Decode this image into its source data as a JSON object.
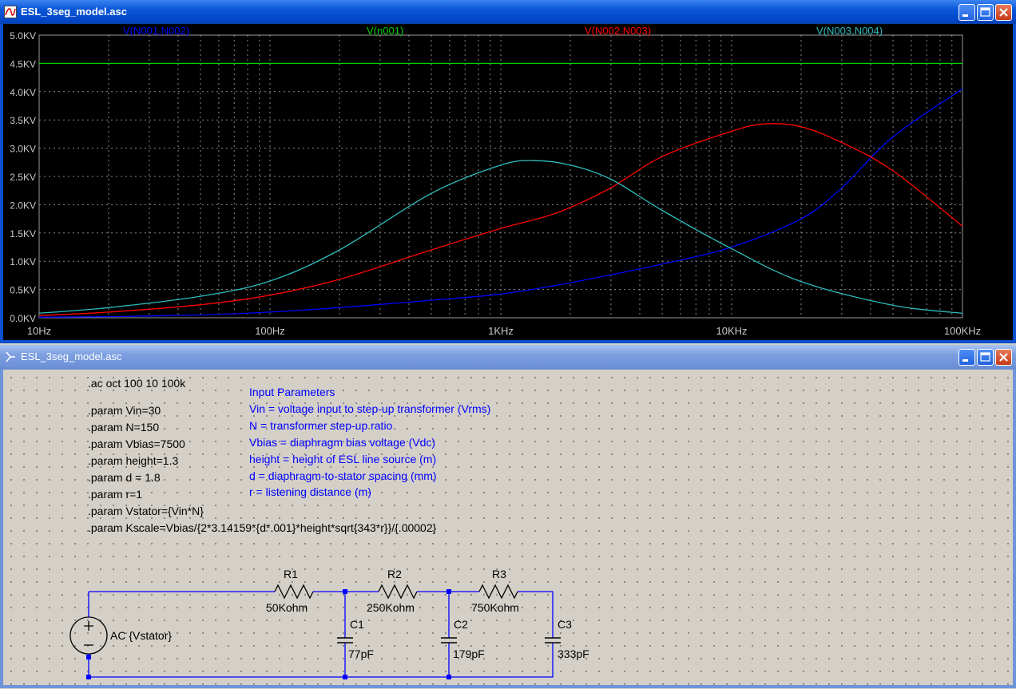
{
  "plot_window": {
    "title": "ESL_3seg_model.asc",
    "icon": "waveform-icon",
    "buttons": [
      "minimize-icon",
      "maximize-icon",
      "close-icon"
    ]
  },
  "schematic_window": {
    "title": "ESL_3seg_model.asc",
    "icon": "schematic-icon",
    "buttons": [
      "minimize-icon",
      "maximize-icon",
      "close-icon"
    ]
  },
  "colors": {
    "plot_bg": "#000000",
    "grid": "#8a8a8a",
    "axis_text": "#c8c8c8",
    "trace_blue": "#0000ff",
    "trace_green": "#00d000",
    "trace_red": "#ff0000",
    "trace_cyan": "#2fbcbc",
    "wire": "#0000ff",
    "directive_text": "#000000",
    "comment_text": "#0000ff"
  },
  "chart_data": {
    "type": "line",
    "xscale": "log",
    "xlim": [
      10,
      100000
    ],
    "ylim": [
      0,
      5000
    ],
    "grid": true,
    "xticks": [
      {
        "value": 10,
        "label": "10Hz"
      },
      {
        "value": 100,
        "label": "100Hz"
      },
      {
        "value": 1000,
        "label": "1KHz"
      },
      {
        "value": 10000,
        "label": "10KHz"
      },
      {
        "value": 100000,
        "label": "100KHz"
      }
    ],
    "yticks": [
      {
        "value": 0,
        "label": "0.0KV"
      },
      {
        "value": 500,
        "label": "0.5KV"
      },
      {
        "value": 1000,
        "label": "1.0KV"
      },
      {
        "value": 1500,
        "label": "1.5KV"
      },
      {
        "value": 2000,
        "label": "2.0KV"
      },
      {
        "value": 2500,
        "label": "2.5KV"
      },
      {
        "value": 3000,
        "label": "3.0KV"
      },
      {
        "value": 3500,
        "label": "3.5KV"
      },
      {
        "value": 4000,
        "label": "4.0KV"
      },
      {
        "value": 4500,
        "label": "4.5KV"
      },
      {
        "value": 5000,
        "label": "5.0KV"
      }
    ],
    "series": [
      {
        "name": "V(N001,N002)",
        "color": "#0000ff",
        "x": [
          10,
          20,
          50,
          100,
          200,
          500,
          1000,
          2000,
          5000,
          10000,
          20000,
          30000,
          50000,
          100000
        ],
        "y": [
          10,
          20,
          50,
          100,
          180,
          310,
          420,
          620,
          950,
          1250,
          1750,
          2300,
          3200,
          4050
        ]
      },
      {
        "name": "V(n001)",
        "color": "#00d000",
        "x": [
          10,
          100000
        ],
        "y": [
          4500,
          4500
        ]
      },
      {
        "name": "V(N002,N003)",
        "color": "#ff0000",
        "x": [
          10,
          20,
          50,
          100,
          200,
          500,
          1000,
          1500,
          2000,
          3000,
          5000,
          10000,
          14000,
          20000,
          30000,
          50000,
          100000
        ],
        "y": [
          40,
          100,
          230,
          400,
          680,
          1200,
          1580,
          1770,
          1950,
          2300,
          2850,
          3300,
          3430,
          3380,
          3100,
          2600,
          1620
        ]
      },
      {
        "name": "V(N003,N004)",
        "color": "#2fbcbc",
        "x": [
          10,
          20,
          50,
          100,
          200,
          500,
          1000,
          1400,
          2000,
          3000,
          5000,
          10000,
          20000,
          50000,
          100000
        ],
        "y": [
          80,
          180,
          380,
          650,
          1200,
          2200,
          2700,
          2780,
          2700,
          2450,
          1900,
          1220,
          640,
          220,
          80
        ]
      }
    ]
  },
  "schematic": {
    "directives": [
      ".ac oct 100 10 100k",
      ".param Vin=30",
      ".param N=150",
      ".param Vbias=7500",
      ".param height=1.3",
      ".param d = 1.8",
      ".param r=1",
      ".param Vstator={Vin*N}",
      ".param Kscale=Vbias/{2*3.14159*{d*.001}*height*sqrt{343*r}}/{.00002}"
    ],
    "comments": [
      "Input Parameters",
      "Vin = voltage input to step-up transformer (Vrms)",
      "N = transformer step-up ratio",
      "Vbias = diaphragm bias voltage (Vdc)",
      "height = height of ESL line source (m)",
      "d = diaphragm-to-stator spacing (mm)",
      "r = listening distance (m)"
    ],
    "source": {
      "label": "AC {Vstator}"
    },
    "resistors": [
      {
        "name": "R1",
        "value": "50Kohm"
      },
      {
        "name": "R2",
        "value": "250Kohm"
      },
      {
        "name": "R3",
        "value": "750Kohm"
      }
    ],
    "capacitors": [
      {
        "name": "C1",
        "value": "77pF"
      },
      {
        "name": "C2",
        "value": "179pF"
      },
      {
        "name": "C3",
        "value": "333pF"
      }
    ]
  }
}
